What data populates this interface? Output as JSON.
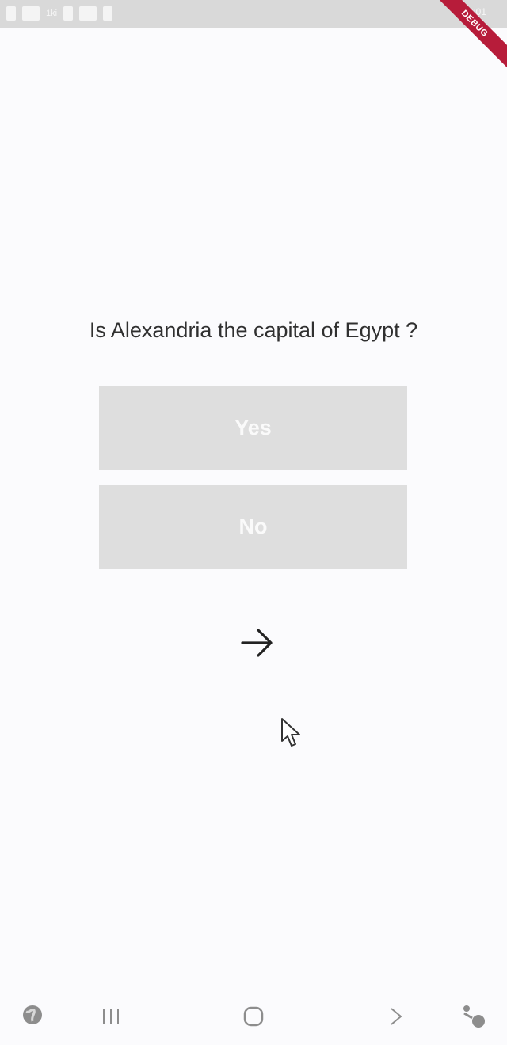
{
  "status_bar": {
    "left_text": "1ki",
    "right_text": "9:01"
  },
  "debug_banner": {
    "label": "DEBUG"
  },
  "quiz": {
    "question": "Is Alexandria the capital of Egypt ?",
    "answers": {
      "yes": "Yes",
      "no": "No"
    }
  },
  "icons": {
    "next": "arrow-right-icon",
    "cursor": "mouse-cursor-icon",
    "nav": [
      "globe-icon",
      "recent-apps-icon",
      "home-icon",
      "forward-icon",
      "accessibility-icon"
    ]
  },
  "colors": {
    "background": "#fbfbfd",
    "button": "#dedede",
    "button_text": "#fafafa",
    "debug": "#b71c3a",
    "question_text": "#303030"
  }
}
